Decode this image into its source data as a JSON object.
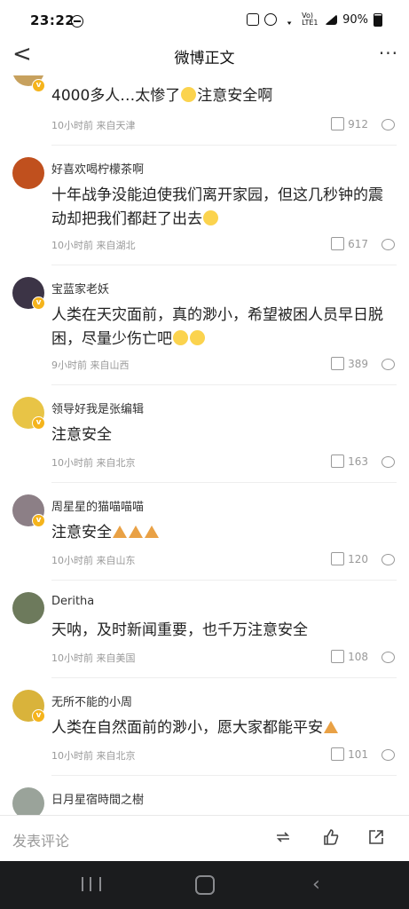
{
  "status": {
    "time": "23:22",
    "battery": "90%",
    "network": "Vo) LTE1"
  },
  "header": {
    "title": "微博正文",
    "more": "···",
    "back": "<"
  },
  "comments": [
    {
      "name": "",
      "text": "4000多人…太惨了",
      "text_after": "注意安全啊",
      "time": "10小时前",
      "source": "来自天津",
      "likes": "912"
    },
    {
      "name": "好喜欢喝柠檬茶啊",
      "text": "十年战争没能迫使我们离开家园，但这几秒钟的震动却把我们都赶了出去",
      "time": "10小时前",
      "source": "来自湖北",
      "likes": "617"
    },
    {
      "name": "宝蓝家老妖",
      "text": "人类在天灾面前，真的渺小，希望被困人员早日脱困，尽量少伤亡吧",
      "time": "9小时前",
      "source": "来自山西",
      "likes": "389"
    },
    {
      "name": "领导好我是张编辑",
      "text": "注意安全",
      "time": "10小时前",
      "source": "来自北京",
      "likes": "163"
    },
    {
      "name": "周星星的猫喵喵喵",
      "text": "注意安全",
      "time": "10小时前",
      "source": "来自山东",
      "likes": "120"
    },
    {
      "name": "Deritha",
      "text": "天呐，及时新闻重要，也千万注意安全",
      "time": "10小时前",
      "source": "来自美国",
      "likes": "108"
    },
    {
      "name": "无所不能的小周",
      "text": "人类在自然面前的渺小，愿大家都能平安",
      "time": "10小时前",
      "source": "来自北京",
      "likes": "101"
    },
    {
      "name": "日月星宿時間之樹",
      "text": "",
      "time": "",
      "source": "",
      "likes": ""
    }
  ],
  "bottom": {
    "placeholder": "发表评论"
  },
  "colors": {
    "accent": "#f5b41c",
    "nav_bg": "#1b1c1e"
  }
}
